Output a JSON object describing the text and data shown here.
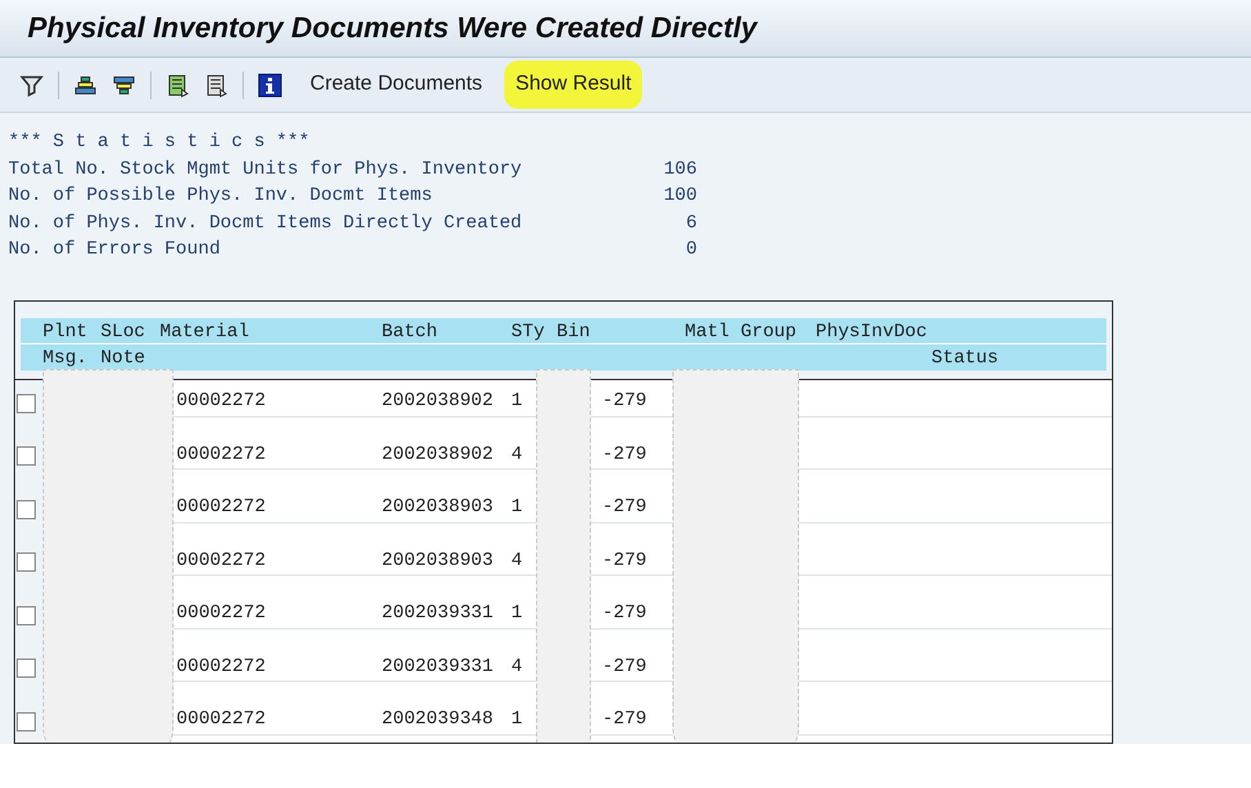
{
  "window": {
    "title": "Physical Inventory Documents Were Created Directly"
  },
  "toolbar": {
    "icons": [
      {
        "kind": "filter"
      },
      {
        "kind": "sort-up"
      },
      {
        "kind": "sort-down"
      },
      {
        "kind": "list"
      },
      {
        "kind": "list2"
      },
      {
        "kind": "info"
      }
    ],
    "buttons": [
      {
        "label": "Create Documents",
        "highlighted": false
      },
      {
        "label": "Show Result",
        "highlighted": true
      }
    ]
  },
  "statistics": {
    "heading": "*** S t a t i s t i c s ***",
    "lines": [
      {
        "label": "Total No. Stock Mgmt Units for Phys. Inventory",
        "value": "106"
      },
      {
        "label": "No. of Possible Phys. Inv. Docmt Items",
        "value": "100"
      },
      {
        "label": "No. of Phys. Inv. Docmt Items Directly Created",
        "value": "6"
      },
      {
        "label": "No. of Errors Found",
        "value": "0"
      }
    ]
  },
  "table": {
    "header_line_1": [
      "Plnt",
      "SLoc",
      "Material",
      "Batch",
      "STy",
      "Bin",
      "Matl Group",
      "PhysInvDoc"
    ],
    "header_line_2": [
      "Msg.",
      "Note",
      "Status"
    ],
    "rows": [
      {
        "checked": false,
        "material": "00002272",
        "batch": "2002038902",
        "sty": "1",
        "bin": "-279"
      },
      {
        "checked": false,
        "material": "00002272",
        "batch": "2002038902",
        "sty": "4",
        "bin": "-279"
      },
      {
        "checked": false,
        "material": "00002272",
        "batch": "2002038903",
        "sty": "1",
        "bin": "-279"
      },
      {
        "checked": false,
        "material": "00002272",
        "batch": "2002038903",
        "sty": "4",
        "bin": "-279"
      },
      {
        "checked": false,
        "material": "00002272",
        "batch": "2002039331",
        "sty": "1",
        "bin": "-279"
      },
      {
        "checked": false,
        "material": "00002272",
        "batch": "2002039331",
        "sty": "4",
        "bin": "-279"
      },
      {
        "checked": false,
        "material": "00002272",
        "batch": "2002039348",
        "sty": "1",
        "bin": "-279"
      }
    ]
  }
}
